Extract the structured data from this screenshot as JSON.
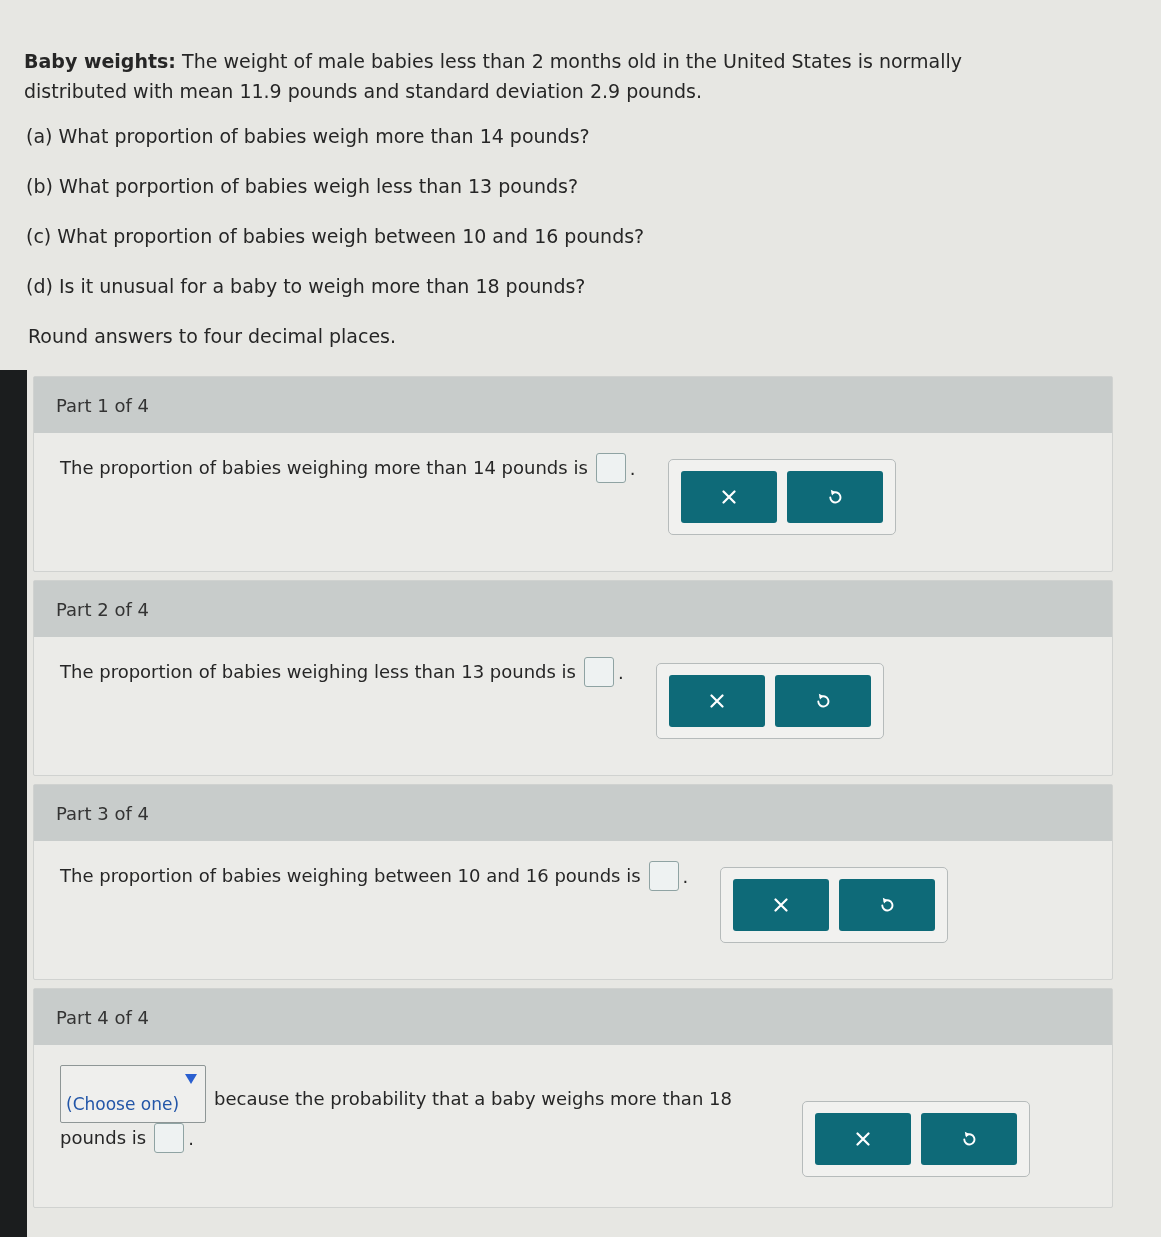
{
  "problem": {
    "intro": "**Baby weights:** The weight of male babies less than 2 months old in the United States is normally distributed with mean 11.9 pounds and standard deviation 2.9 pounds.",
    "questions": [
      "(a) What proportion of babies weigh more than 14 pounds?",
      "(b) What porportion of babies weigh less than 13 pounds?",
      "(c) What proportion of babies weigh between 10 and 16 pounds?",
      "(d) Is it unusual for a baby to weigh more than 18 pounds?"
    ],
    "instruction": "Round answers to four decimal places."
  },
  "parts": [
    {
      "kind": "sentence",
      "header": "Part 1 of 4",
      "text": "The proportion of babies weighing more than 14 pounds is",
      "end": ".",
      "buttons": [
        {
          "kind": "clear"
        },
        {
          "kind": "reset"
        }
      ]
    },
    {
      "kind": "sentence",
      "header": "Part 2 of 4",
      "text": "The proportion of babies weighing less than 13 pounds is",
      "end": ".",
      "buttons": [
        {
          "kind": "clear"
        },
        {
          "kind": "reset"
        }
      ]
    },
    {
      "kind": "sentence",
      "header": "Part 3 of 4",
      "text": "The proportion of babies weighing between 10 and 16 pounds is",
      "end": ".",
      "buttons": [
        {
          "kind": "clear"
        },
        {
          "kind": "reset"
        }
      ]
    },
    {
      "kind": "choice",
      "header": "Part 4 of 4",
      "dropdown": {
        "placeholder": "(Choose one)"
      },
      "text": "because the probability that a baby weighs more than 18",
      "text_continued": "pounds is",
      "end": ".",
      "buttons": [
        {
          "kind": "clear"
        },
        {
          "kind": "reset"
        }
      ]
    }
  ]
}
